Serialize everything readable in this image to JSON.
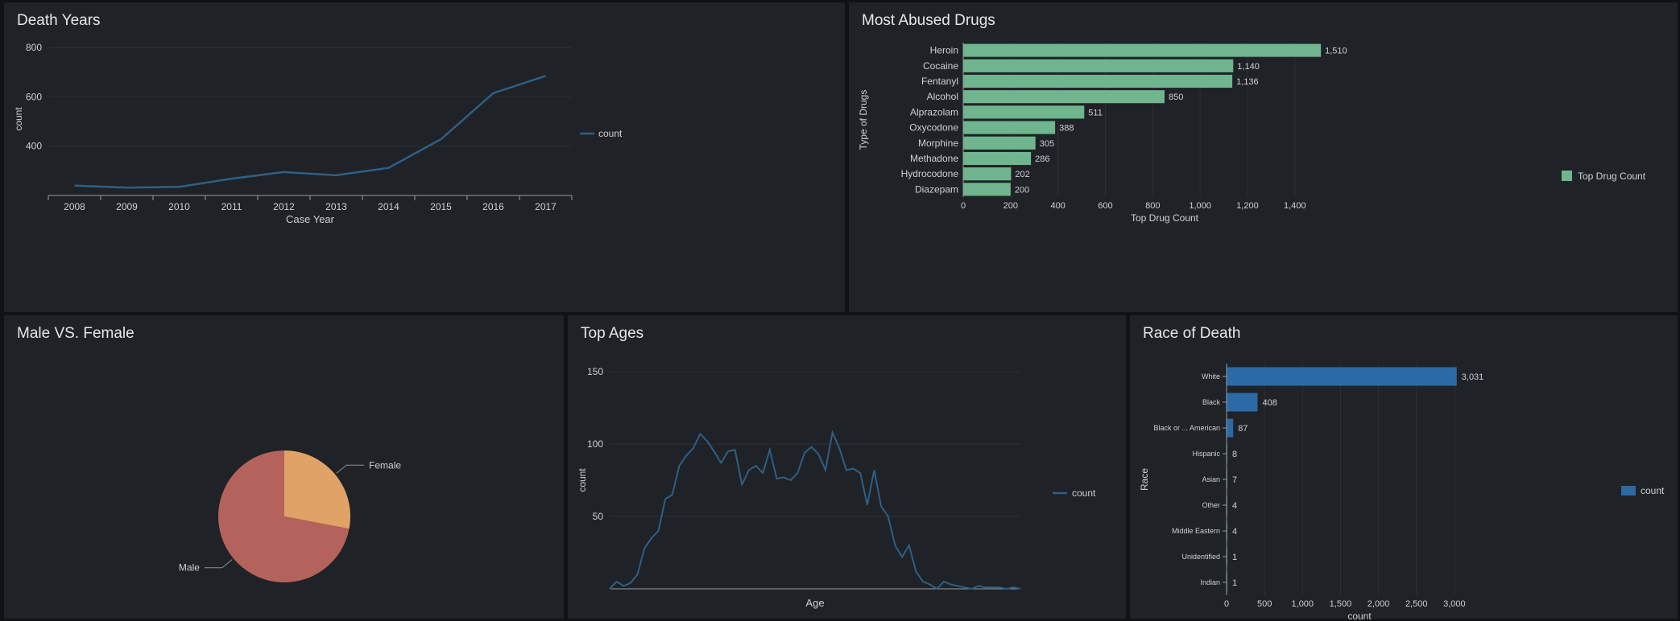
{
  "colors": {
    "line": "#2f5f86",
    "green_bar": "#6fb58d",
    "blue_bar": "#2c6aa6",
    "pie_male": "#b4625c",
    "pie_female": "#e0a266"
  },
  "panels": {
    "death_years": "Death Years",
    "drugs": "Most Abused Drugs",
    "gender": "Male VS. Female",
    "ages": "Top Ages",
    "race": "Race of Death"
  },
  "chart_data": [
    {
      "type": "line",
      "title": "Death Years",
      "xlabel": "Case Year",
      "ylabel": "count",
      "x": [
        "2008",
        "2009",
        "2010",
        "2011",
        "2012",
        "2013",
        "2014",
        "2015",
        "2016",
        "2017"
      ],
      "series": [
        {
          "name": "count",
          "values": [
            240,
            232,
            235,
            268,
            295,
            282,
            312,
            428,
            615,
            685
          ]
        }
      ],
      "yticks": [
        400,
        600,
        800
      ],
      "ylim": [
        200,
        820
      ],
      "legend": "right",
      "grid": true
    },
    {
      "type": "bar",
      "orientation": "horizontal",
      "title": "Most Abused Drugs",
      "xlabel": "Top Drug Count",
      "ylabel": "Type of Drugs",
      "categories": [
        "Heroin",
        "Cocaine",
        "Fentanyl",
        "Alcohol",
        "Alprazolam",
        "Oxycodone",
        "Morphine",
        "Methadone",
        "Hydrocodone",
        "Diazepam"
      ],
      "values": [
        1510,
        1140,
        1136,
        850,
        511,
        388,
        305,
        286,
        202,
        200
      ],
      "labels": [
        "1,510",
        "1,140",
        "1,136",
        "850",
        "511",
        "388",
        "305",
        "286",
        "202",
        "200"
      ],
      "series": [
        {
          "name": "Top Drug Count"
        }
      ],
      "xticks": [
        0,
        200,
        400,
        600,
        800,
        1000,
        1200,
        1400
      ],
      "xtick_labels": [
        "0",
        "200",
        "400",
        "600",
        "800",
        "1,000",
        "1,200",
        "1,400"
      ],
      "xlim": [
        0,
        1700
      ],
      "legend": "right"
    },
    {
      "type": "pie",
      "title": "Male VS. Female",
      "categories": [
        "Female",
        "Male"
      ],
      "values": [
        28,
        72
      ]
    },
    {
      "type": "line",
      "title": "Top Ages",
      "xlabel": "Age",
      "ylabel": "count",
      "series": [
        {
          "name": "count",
          "values": [
            0,
            5,
            2,
            4,
            10,
            28,
            35,
            40,
            62,
            65,
            85,
            92,
            97,
            107,
            102,
            95,
            87,
            95,
            96,
            72,
            82,
            85,
            80,
            96,
            76,
            77,
            75,
            80,
            94,
            98,
            93,
            82,
            108,
            97,
            82,
            83,
            80,
            58,
            82,
            57,
            50,
            30,
            22,
            30,
            12,
            5,
            3,
            0,
            5,
            3,
            2,
            1,
            0,
            2,
            1,
            1,
            1,
            0,
            1,
            0
          ]
        }
      ],
      "yticks": [
        50,
        100,
        150
      ],
      "ylim": [
        0,
        150
      ],
      "legend": "right",
      "grid": true
    },
    {
      "type": "bar",
      "orientation": "horizontal",
      "title": "Race of Death",
      "xlabel": "count",
      "ylabel": "Race",
      "categories": [
        "White",
        "Black",
        "Black or ... American",
        "Hispanic",
        "Asian",
        "Other",
        "Middle Eastern",
        "Unidentified",
        "Indian"
      ],
      "values": [
        3031,
        408,
        87,
        8,
        7,
        4,
        4,
        1,
        1
      ],
      "labels": [
        "3,031",
        "408",
        "87",
        "8",
        "7",
        "4",
        "4",
        "1",
        "1"
      ],
      "series": [
        {
          "name": "count"
        }
      ],
      "xticks": [
        0,
        500,
        1000,
        1500,
        2000,
        2500,
        3000
      ],
      "xtick_labels": [
        "0",
        "500",
        "1,000",
        "1,500",
        "2,000",
        "2,500",
        "3,000"
      ],
      "xlim": [
        0,
        3500
      ],
      "legend": "right"
    }
  ]
}
